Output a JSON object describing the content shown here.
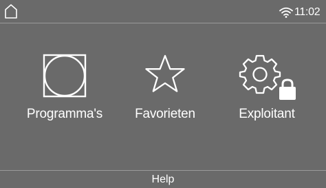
{
  "status_bar": {
    "home_icon": "home-icon",
    "wifi_icon": "wifi-icon",
    "time": "11:02"
  },
  "menu": {
    "items": [
      {
        "id": "programs",
        "label": "Programma's",
        "icon": "drum-icon"
      },
      {
        "id": "favorites",
        "label": "Favorieten",
        "icon": "star-icon"
      },
      {
        "id": "operator",
        "label": "Exploitant",
        "icon": "gear-lock-icon"
      }
    ]
  },
  "bottom_bar": {
    "help_label": "Help"
  },
  "colors": {
    "background": "#6a6a6a",
    "foreground": "#ffffff",
    "divider": "#9a9a9a"
  }
}
